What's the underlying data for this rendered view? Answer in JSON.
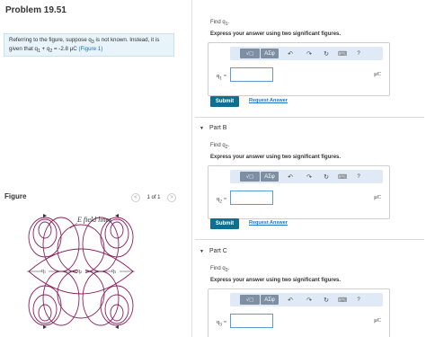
{
  "problem_title": "Problem 19.51",
  "intro": {
    "line1": "Referring to the figure, suppose q",
    "line1_sub": "3",
    "line1_rest": " is not known. Instead, it is",
    "line2": "given that q",
    "line2_sub1": "1",
    "line2_mid": " + q",
    "line2_sub2": "2",
    "line2_value": " = -2.8 μC ",
    "figure_link": "(Figure 1)"
  },
  "figure": {
    "label": "Figure",
    "pager_text": "1 of 1",
    "prev_icon": "<",
    "next_icon": ">",
    "field_label": "E field lines",
    "charge_labels": [
      "q",
      "q",
      "q"
    ],
    "charge_subs": [
      "1",
      "2",
      "3"
    ]
  },
  "toolbar": {
    "sqrt_label": "√□",
    "greek_label": "AΣφ",
    "undo_icon": "↶",
    "redo_icon": "↷",
    "reset_icon": "↻",
    "keyboard_icon": "⌨",
    "help_label": "?"
  },
  "parts": [
    {
      "header": "",
      "find": "Find q",
      "find_sub": "1",
      "instruction": "Express your answer using two significant figures.",
      "var": "q",
      "var_sub": "1",
      "unit": "μC",
      "value": "",
      "submit": "Submit",
      "request": "Request Answer"
    },
    {
      "header": "Part B",
      "find": "Find q",
      "find_sub": "2",
      "instruction": "Express your answer using two significant figures.",
      "var": "q",
      "var_sub": "2",
      "unit": "μC",
      "value": "",
      "submit": "Submit",
      "request": "Request Answer"
    },
    {
      "header": "Part C",
      "find": "Find q",
      "find_sub": "3",
      "instruction": "Express your answer using two significant figures.",
      "var": "q",
      "var_sub": "3",
      "unit": "μC",
      "value": ""
    }
  ]
}
